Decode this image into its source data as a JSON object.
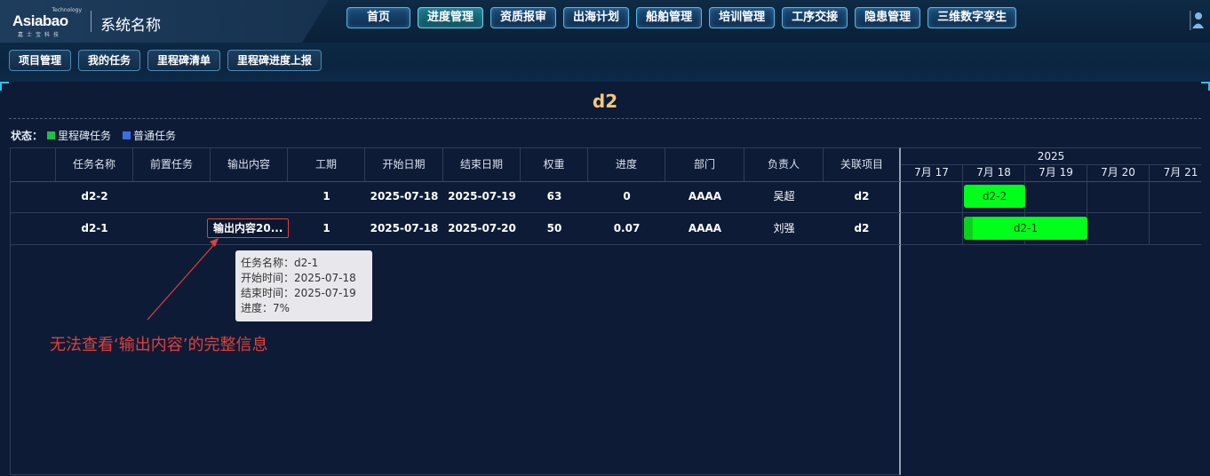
{
  "header": {
    "logo": {
      "brand": "Asiabao",
      "tagline": "Technology",
      "sub": "嘉士宝科技"
    },
    "system_name": "系统名称",
    "main_nav": [
      "首页",
      "进度管理",
      "资质报审",
      "出海计划",
      "船舶管理",
      "培训管理",
      "工序交接",
      "隐患管理",
      "三维数字孪生"
    ],
    "active_main": "进度管理"
  },
  "sub_nav": [
    "项目管理",
    "我的任务",
    "里程碑清单",
    "里程碑进度上报"
  ],
  "page_title": "d2",
  "legend": {
    "label": "状态：",
    "items": [
      {
        "label": "里程碑任务",
        "color": "#1fbf4a"
      },
      {
        "label": "普通任务",
        "color": "#3a6fe6"
      }
    ]
  },
  "table": {
    "columns": [
      "",
      "任务名称",
      "前置任务",
      "输出内容",
      "工期",
      "开始日期",
      "结束日期",
      "权重",
      "进度",
      "部门",
      "负责人",
      "关联项目"
    ],
    "rows": [
      {
        "name": "d2-2",
        "pre": "",
        "output": "",
        "duration": "1",
        "start": "2025-07-18",
        "end": "2025-07-19",
        "weight": "63",
        "progress": "0",
        "dept": "AAAA",
        "owner": "吴超",
        "project": "d2"
      },
      {
        "name": "d2-1",
        "pre": "",
        "output": "输出内容20...",
        "duration": "1",
        "start": "2025-07-18",
        "end": "2025-07-20",
        "weight": "50",
        "progress": "0.07",
        "dept": "AAAA",
        "owner": "刘强",
        "project": "d2"
      }
    ]
  },
  "gantt": {
    "year": "2025",
    "days": [
      "7月 17",
      "7月 18",
      "7月 19",
      "7月 20",
      "7月 21"
    ],
    "bars": [
      {
        "label": "d2-2",
        "start_day": "7月 18",
        "end_day": "7月 19",
        "progress": 0
      },
      {
        "label": "d2-1",
        "start_day": "7月 18",
        "end_day": "7月 20",
        "progress": 0.07
      }
    ]
  },
  "tooltip": {
    "lines": [
      "任务名称：d2-1",
      "开始时间：2025-07-18",
      "结束时间：2025-07-19",
      "进度：7%"
    ]
  },
  "annotation": "无法查看‘输出内容’的完整信息",
  "colors": {
    "accent": "#f2c97b",
    "bar": "#00ff1a",
    "annotation": "#e0403a"
  }
}
